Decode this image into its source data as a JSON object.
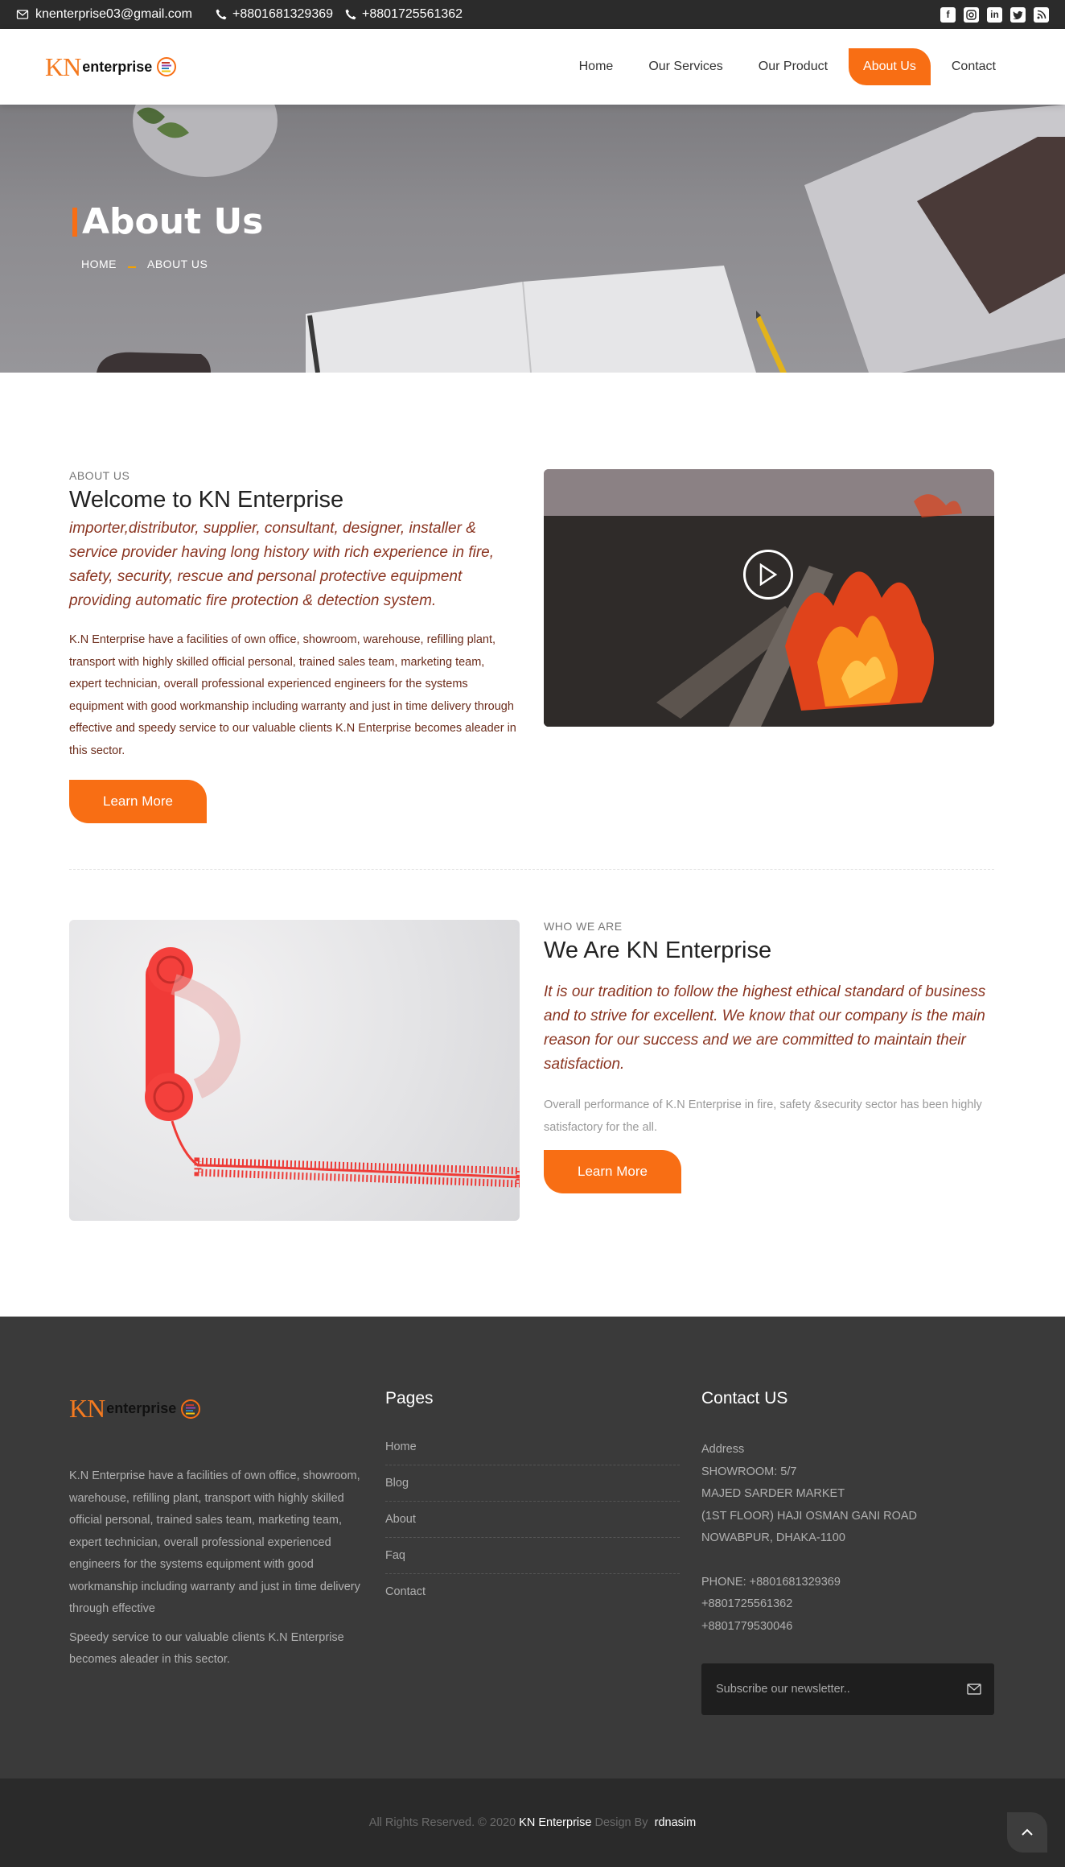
{
  "topbar": {
    "email": "knenterprise03@gmail.com",
    "phone1": "+8801681329369",
    "phone2": "+8801725561362",
    "social": [
      "facebook-icon",
      "instagram-icon",
      "linkedin-icon",
      "twitter-icon",
      "rss-icon"
    ]
  },
  "header": {
    "logo_kn": "KN",
    "logo_ent": "enterprise",
    "nav": [
      {
        "label": "Home"
      },
      {
        "label": "Our Services"
      },
      {
        "label": "Our Product"
      },
      {
        "label": "About Us",
        "active": true
      },
      {
        "label": "Contact"
      }
    ]
  },
  "hero": {
    "title": "About Us",
    "crumb_home": "HOME",
    "crumb_current": "ABOUT US"
  },
  "about": {
    "eyebrow": "ABOUT US",
    "title": "Welcome to KN Enterprise",
    "lead": "importer,distributor, supplier, consultant, designer, installer & service provider having long history with rich experience in fire, safety, security, rescue and personal protective equipment providing automatic fire protection & detection system.",
    "body": "K.N Enterprise have a facilities of own office, showroom, warehouse, refilling plant, transport with highly skilled official personal, trained sales team, marketing team, expert technician, overall professional experienced engineers for the systems equipment with good workmanship including warranty and just in time delivery through effective and speedy service to our valuable clients K.N Enterprise becomes aleader in this sector.",
    "button": "Learn More"
  },
  "who": {
    "eyebrow": "WHO WE ARE",
    "title": "We Are KN Enterprise",
    "lead": "It is our tradition to follow the highest ethical standard of business and to strive for excellent. We know that our company is the main reason for our success and we are committed to maintain their satisfaction.",
    "body": "Overall performance of K.N Enterprise in fire, safety &security sector has been highly satisfactory for the all.",
    "button": "Learn More"
  },
  "footer": {
    "about_text1": "K.N Enterprise have a facilities of own office, showroom, warehouse, refilling plant, transport with highly skilled official personal, trained sales team, marketing team, expert technician, overall professional experienced engineers for the systems equipment with good workmanship including warranty and just in time delivery through effective",
    "about_text2": "Speedy service to our valuable clients K.N Enterprise becomes aleader in this sector.",
    "pages_title": "Pages",
    "pages": [
      "Home",
      "Blog",
      "About",
      "Faq",
      "Contact"
    ],
    "contact_title": "Contact US",
    "address_label": "Address",
    "address_lines": [
      "SHOWROOM: 5/7",
      "MAJED SARDER MARKET",
      "(1ST FLOOR) HAJI OSMAN GANI ROAD",
      "NOWABPUR, DHAKA-1100"
    ],
    "phone_lines": [
      "PHONE: +8801681329369",
      "+8801725561362",
      "+8801779530046"
    ],
    "newsletter_placeholder": "Subscribe our newsletter.."
  },
  "bottom": {
    "rights": "All Rights Reserved. © 2020",
    "brand": "KN Enterprise",
    "design_by": "Design By",
    "designer": "rdnasim"
  },
  "colors": {
    "accent": "#f86e14",
    "dark": "#2b2b2b",
    "footer": "#3a3a3a",
    "lead_brown": "#8a3420"
  }
}
